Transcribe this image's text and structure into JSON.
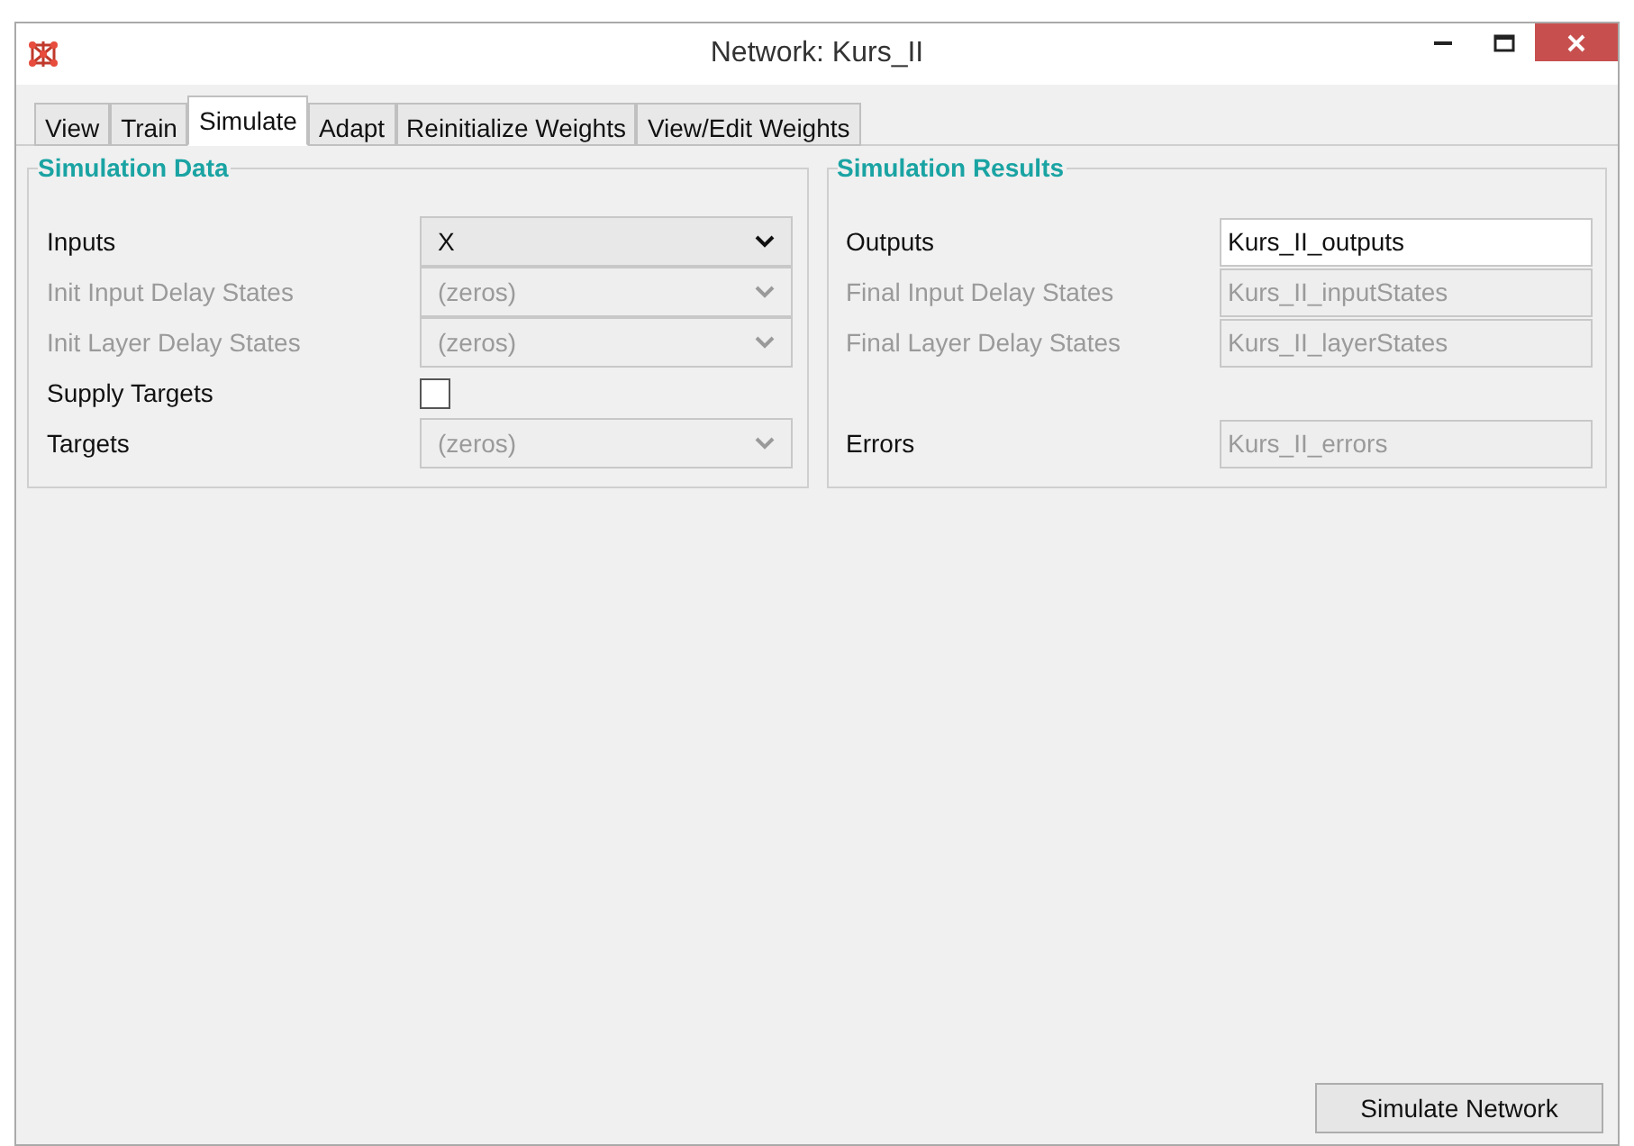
{
  "window": {
    "title": "Network: Kurs_II"
  },
  "tabs": [
    {
      "label": "View",
      "selected": false
    },
    {
      "label": "Train",
      "selected": false
    },
    {
      "label": "Simulate",
      "selected": true
    },
    {
      "label": "Adapt",
      "selected": false
    },
    {
      "label": "Reinitialize Weights",
      "selected": false
    },
    {
      "label": "View/Edit Weights",
      "selected": false
    }
  ],
  "simulation_data": {
    "title": "Simulation Data",
    "rows": [
      {
        "kind": "select",
        "label": "Inputs",
        "label_disabled": false,
        "value": "X",
        "disabled": false
      },
      {
        "kind": "select",
        "label": "Init Input Delay States",
        "label_disabled": true,
        "value": "(zeros)",
        "disabled": true
      },
      {
        "kind": "select",
        "label": "Init Layer Delay States",
        "label_disabled": true,
        "value": "(zeros)",
        "disabled": true
      },
      {
        "kind": "checkbox",
        "label": "Supply Targets",
        "label_disabled": false,
        "checked": false
      },
      {
        "kind": "select",
        "label": "Targets",
        "label_disabled": false,
        "value": "(zeros)",
        "disabled": true
      }
    ]
  },
  "simulation_results": {
    "title": "Simulation Results",
    "rows": [
      {
        "label": "Outputs",
        "label_disabled": false,
        "value": "Kurs_II_outputs",
        "disabled": false
      },
      {
        "label": "Final Input Delay States",
        "label_disabled": true,
        "value": "Kurs_II_inputStates",
        "disabled": true
      },
      {
        "label": "Final Layer Delay States",
        "label_disabled": true,
        "value": "Kurs_II_layerStates",
        "disabled": true
      }
    ],
    "errors": {
      "label": "Errors",
      "label_disabled": false,
      "value": "Kurs_II_errors",
      "disabled": true
    }
  },
  "buttons": [
    {
      "label": "Simulate Network"
    }
  ]
}
